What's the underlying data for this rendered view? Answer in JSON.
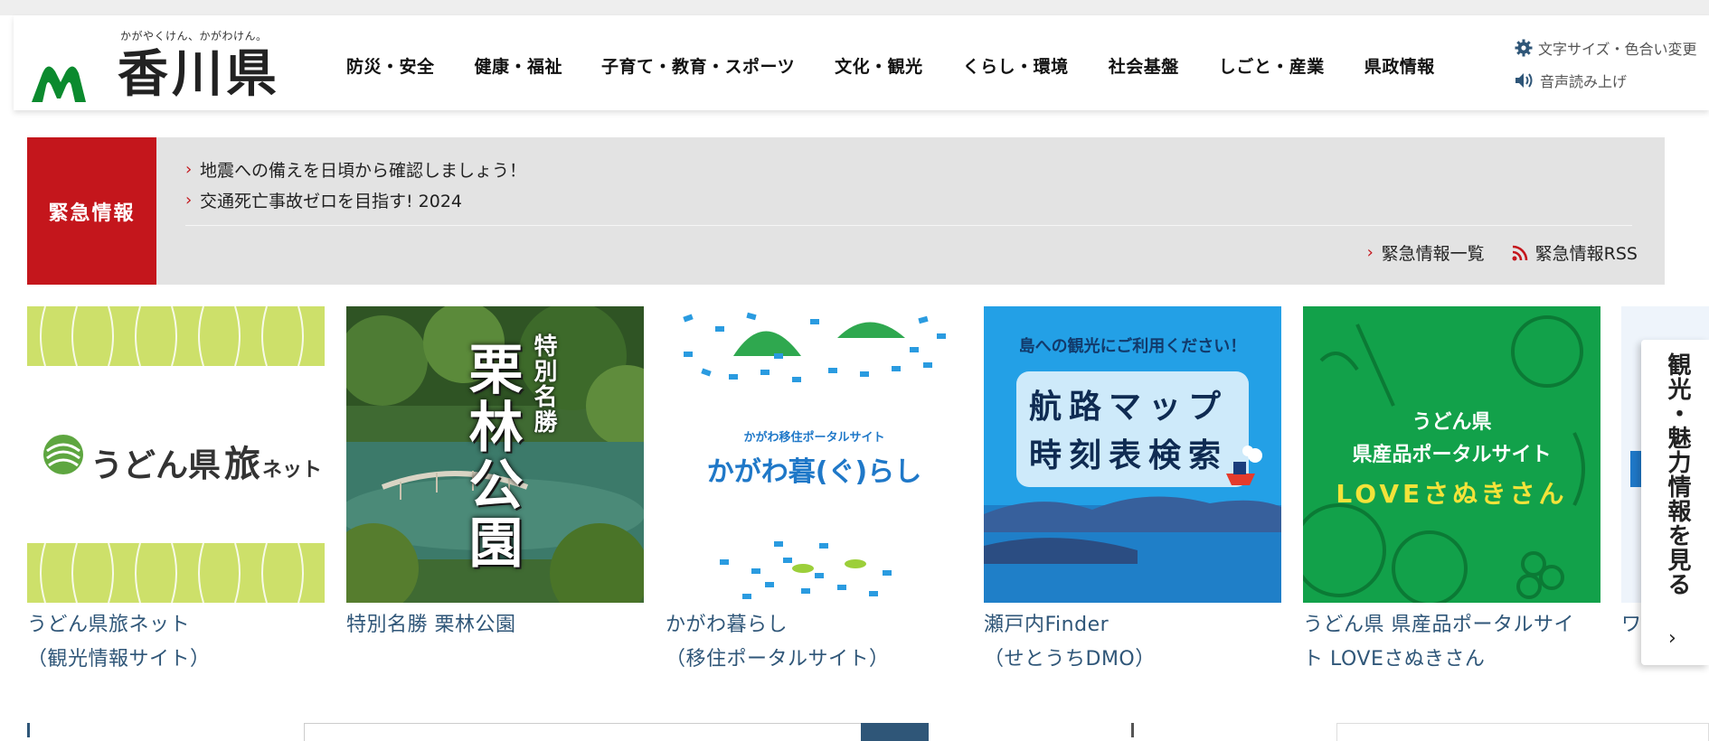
{
  "header": {
    "logo_tagline": "かがやくけん、かがわけん。",
    "logo_name": "香川県",
    "nav": [
      {
        "label": "防災・安全"
      },
      {
        "label": "健康・福祉"
      },
      {
        "label": "子育て・教育・スポーツ"
      },
      {
        "label": "文化・観光"
      },
      {
        "label": "くらし・環境"
      },
      {
        "label": "社会基盤"
      },
      {
        "label": "しごと・産業"
      },
      {
        "label": "県政情報"
      }
    ],
    "util": {
      "text_size": "文字サイズ・色合い変更",
      "read_aloud": "音声読み上げ"
    }
  },
  "emergency": {
    "label": "緊急情報",
    "items": [
      {
        "text": "地震への備えを日頃から確認しましょう！"
      },
      {
        "text": "交通死亡事故ゼロを目指す! 2024"
      }
    ],
    "list_link": "緊急情報一覧",
    "rss_link": "緊急情報RSS"
  },
  "banners": [
    {
      "logo_text": "うどん県",
      "logo_text2": "旅",
      "logo_text3": "ネット",
      "caption1": "うどん県旅ネット",
      "caption2": "（観光情報サイト）"
    },
    {
      "img_text1": "特別名勝",
      "img_text2": "栗林公園",
      "caption1": "特別名勝 栗林公園",
      "caption2": ""
    },
    {
      "img_small": "かがわ移住ポータルサイト",
      "img_text": "かがわ暮(ぐ)らし",
      "caption1": "かがわ暮らし",
      "caption2": "（移住ポータルサイト）"
    },
    {
      "img_top": "島への観光にご利用ください！",
      "img_line1": "航路マップ",
      "img_line2": "時刻表検索",
      "caption1": "瀬戸内Finder",
      "caption2": "（せとうちDMO）"
    },
    {
      "img_line1": "うどん県",
      "img_line2": "県産品ポータルサイト",
      "img_line3": "LOVEさぬきさん",
      "caption1": "うどん県 県産品ポータルサイ",
      "caption2": "ト LOVEさぬきさん"
    },
    {
      "caption1": "ワ",
      "caption2": ""
    }
  ],
  "side_tab": {
    "label": "観光・魅力情報を見る",
    "arrow": "›"
  },
  "colors": {
    "emergency_red": "#c4161c",
    "link_blue": "#2f5678",
    "udon_green": "#cde06a",
    "kagawa_green": "#12a14a",
    "finder_blue": "#1a8fd8"
  }
}
